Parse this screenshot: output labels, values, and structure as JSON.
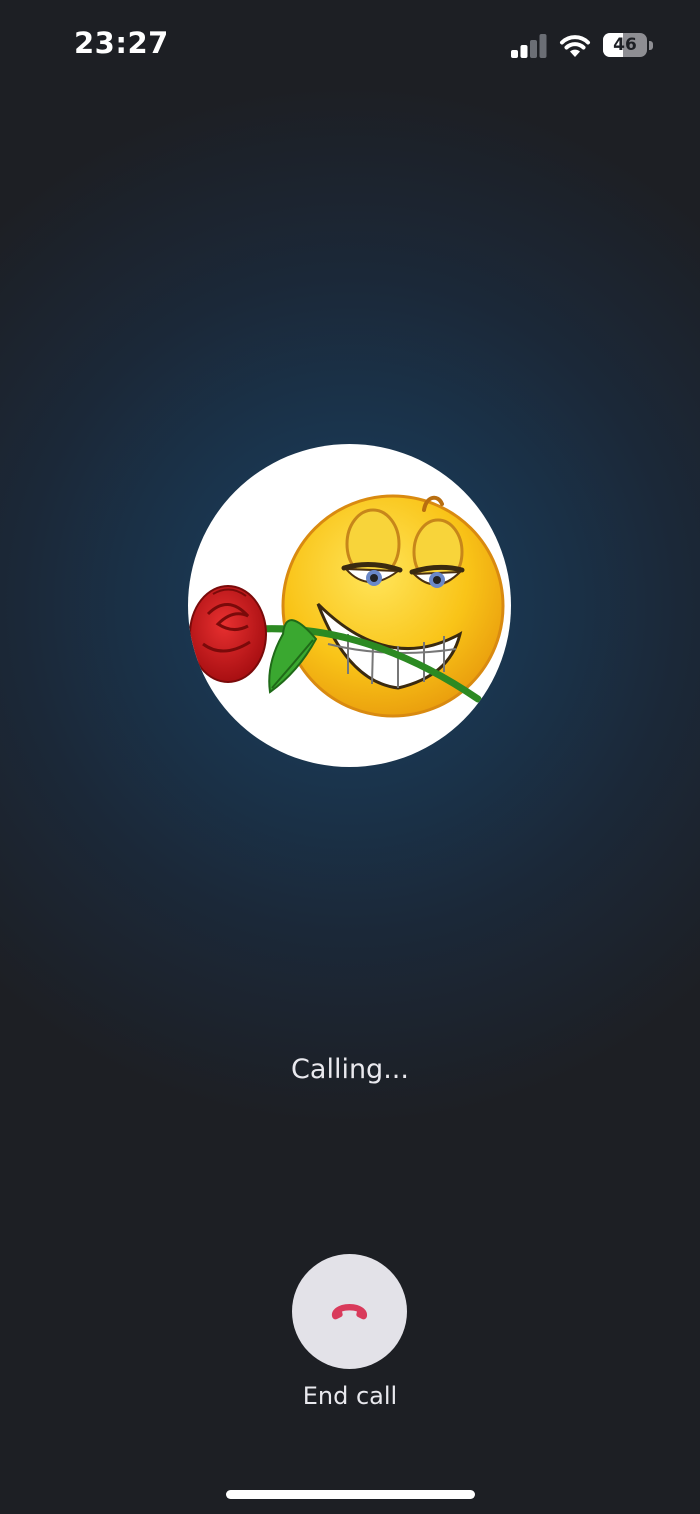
{
  "status_bar": {
    "time": "23:27",
    "battery_level": "46",
    "battery_fraction": 0.46,
    "signal_bars_active": 2,
    "signal_bars_total": 4,
    "icons": [
      "cellular-signal-icon",
      "wifi-icon",
      "battery-icon"
    ]
  },
  "call": {
    "avatar_icon": "smiley-with-rose-avatar",
    "status_text": "Calling...",
    "end_call_label": "End call",
    "end_call_icon": "hang-up-phone-icon",
    "end_call_icon_color": "#d93a5b"
  },
  "colors": {
    "background": "#1d1f24",
    "glow": "#1d4566",
    "button_bg": "#e3e2e8",
    "text": "#e9e9ee"
  }
}
